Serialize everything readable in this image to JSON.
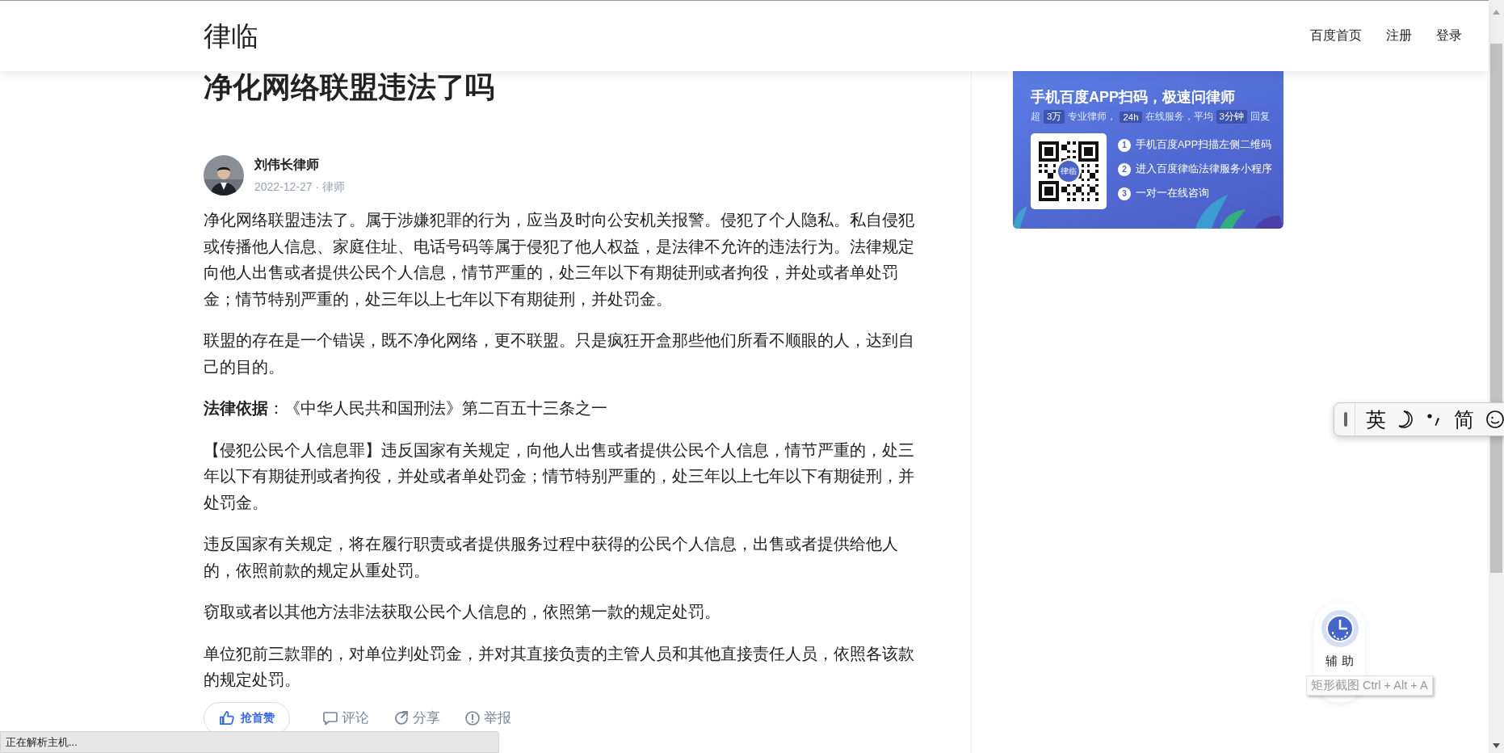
{
  "header": {
    "logo": "律临",
    "nav": [
      {
        "label": "百度首页"
      },
      {
        "label": "注册"
      },
      {
        "label": "登录"
      }
    ]
  },
  "article": {
    "title": "净化网络联盟违法了吗",
    "author": {
      "name": "刘伟长律师",
      "meta": "2022-12-27 · 律师"
    },
    "paragraphs": [
      "净化网络联盟违法了。属于涉嫌犯罪的行为，应当及时向公安机关报警。侵犯了个人隐私。私自侵犯或传播他人信息、家庭住址、电话号码等属于侵犯了他人权益，是法律不允许的违法行为。法律规定向他人出售或者提供公民个人信息，情节严重的，处三年以下有期徒刑或者拘役，并处或者单处罚金；情节特别严重的，处三年以上七年以下有期徒刑，并处罚金。",
      "联盟的存在是一个错误，既不净化网络，更不联盟。只是疯狂开盒那些他们所看不顺眼的人，达到自己的目的。",
      "**法律依据**：《中华人民共和国刑法》第二百五十三条之一",
      "【侵犯公民个人信息罪】违反国家有关规定，向他人出售或者提供公民个人信息，情节严重的，处三年以下有期徒刑或者拘役，并处或者单处罚金；情节特别严重的，处三年以上七年以下有期徒刑，并处罚金。",
      "违反国家有关规定，将在履行职责或者提供服务过程中获得的公民个人信息，出售或者提供给他人的，依照前款的规定从重处罚。",
      "窃取或者以其他方法非法获取公民个人信息的，依照第一款的规定处罚。",
      "单位犯前三款罪的，对单位判处罚金，并对其直接负责的主管人员和其他直接责任人员，依照各该款的规定处罚。"
    ],
    "actions": [
      {
        "kind": "like",
        "label": "抢首赞"
      },
      {
        "kind": "comment",
        "label": "评论"
      },
      {
        "kind": "share",
        "label": "分享"
      },
      {
        "kind": "report",
        "label": "举报"
      }
    ]
  },
  "banner": {
    "title": "手机百度APP扫码，极速问律师",
    "subtitle": [
      {
        "text": "超",
        "highlight": false
      },
      {
        "text": "3万",
        "highlight": true
      },
      {
        "text": "专业律师，",
        "highlight": false
      },
      {
        "text": "24h",
        "highlight": true
      },
      {
        "text": "在线服务，平均",
        "highlight": false
      },
      {
        "text": "3分钟",
        "highlight": true
      },
      {
        "text": "回复",
        "highlight": false
      }
    ],
    "qr_label": "律临",
    "steps": [
      {
        "number": "1",
        "text": "手机百度APP扫描左侧二维码"
      },
      {
        "number": "2",
        "text": "进入百度律临法律服务小程序"
      },
      {
        "number": "3",
        "text": "一对一在线咨询"
      }
    ]
  },
  "ime_bar": {
    "items": [
      {
        "kind": "text",
        "label": "英"
      },
      {
        "kind": "moon"
      },
      {
        "kind": "punct"
      },
      {
        "kind": "text",
        "label": "简"
      },
      {
        "kind": "smiley"
      }
    ]
  },
  "assist": {
    "label": "辅 助"
  },
  "tooltip": "矩形截图 Ctrl + Alt + A",
  "status_bar": "正在解析主机..."
}
